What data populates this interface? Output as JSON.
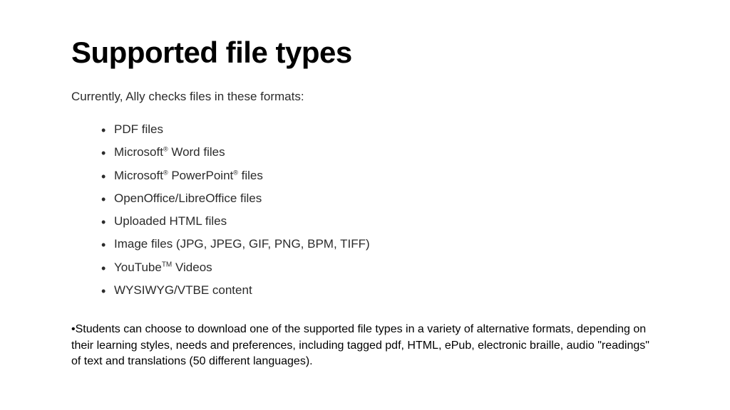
{
  "title": "Supported file types",
  "intro": "Currently, Ally checks files in these formats:",
  "items": [
    "PDF files",
    "Microsoft® Word files",
    "Microsoft® PowerPoint® files",
    "OpenOffice/LibreOffice files",
    "Uploaded HTML files",
    "Image files (JPG, JPEG, GIF, PNG, BPM, TIFF)",
    "YouTube™ Videos",
    "WYSIWYG/VTBE content"
  ],
  "note": "•Students can choose to download one of the supported file types in a variety of alternative formats, depending on their learning styles, needs and preferences, including tagged pdf, HTML, ePub, electronic braille, audio \"readings\" of text and translations (50 different languages)."
}
